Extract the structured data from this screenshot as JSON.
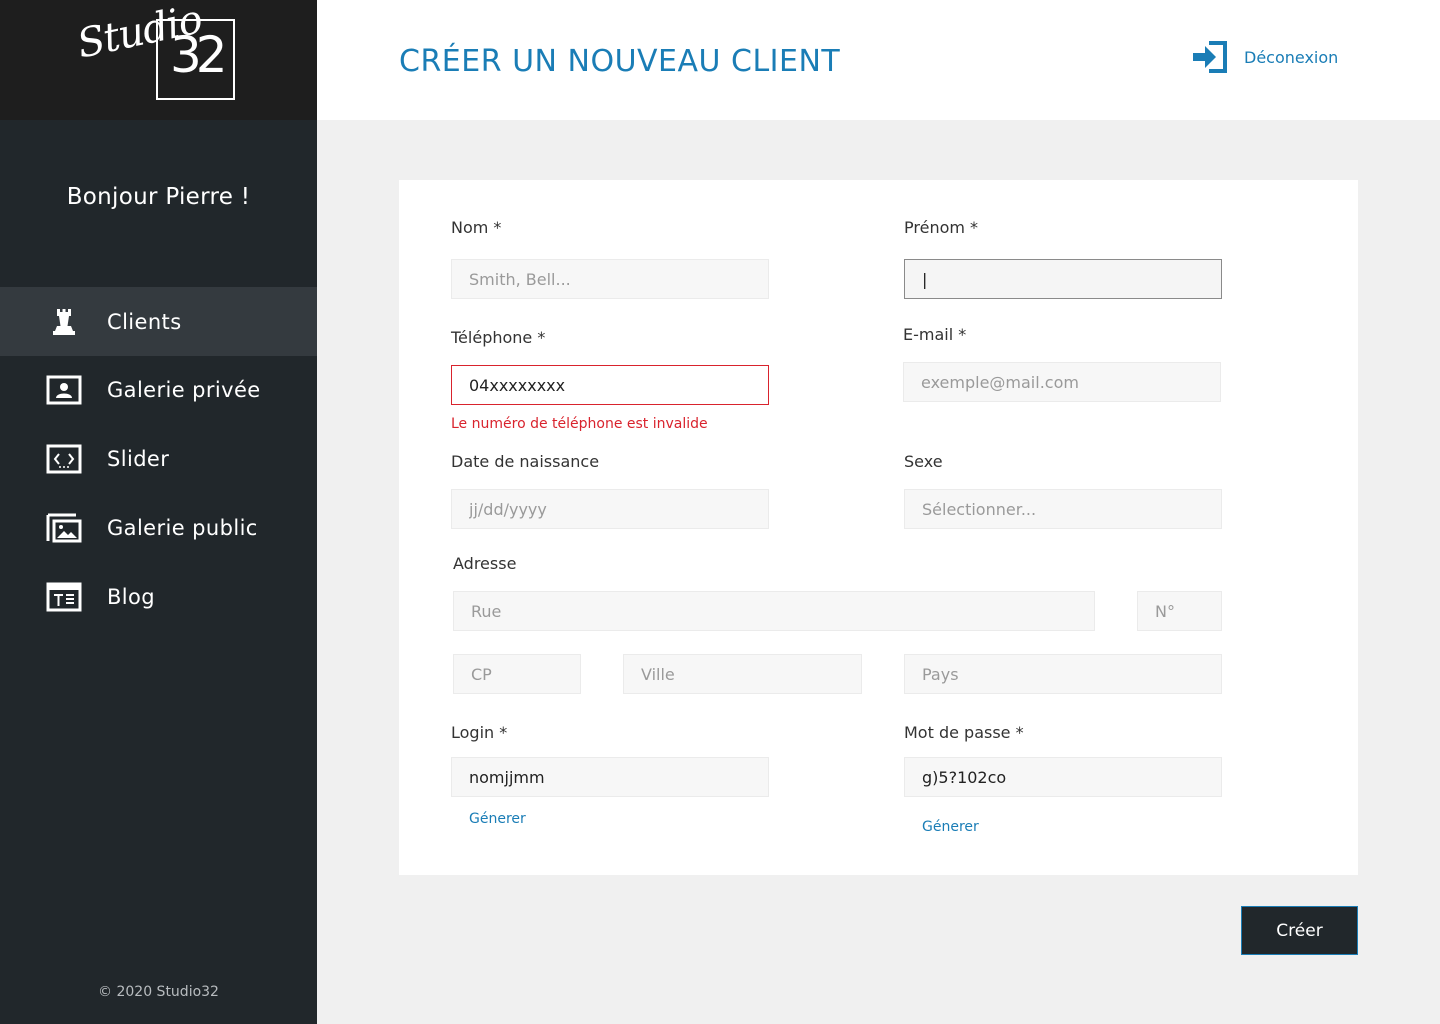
{
  "brand": {
    "script": "Studio",
    "number": "32"
  },
  "sidebar": {
    "greeting": "Bonjour Pierre !",
    "items": [
      {
        "label": "Clients",
        "icon": "chess-piece-icon",
        "active": true
      },
      {
        "label": "Galerie privée",
        "icon": "portrait-frame-icon",
        "active": false
      },
      {
        "label": "Slider",
        "icon": "slider-frame-icon",
        "active": false
      },
      {
        "label": "Galerie public",
        "icon": "image-gallery-icon",
        "active": false
      },
      {
        "label": "Blog",
        "icon": "blog-text-icon",
        "active": false
      }
    ],
    "copyright": "© 2020 Studio32"
  },
  "header": {
    "title": "CRÉER UN NOUVEAU CLIENT",
    "logout_label": "Déconexion",
    "logout_icon": "sign-in-arrow-icon"
  },
  "form": {
    "nom": {
      "label": "Nom *",
      "placeholder": "Smith, Bell...",
      "value": ""
    },
    "prenom": {
      "label": "Prénom *",
      "placeholder": "",
      "value": "|"
    },
    "telephone": {
      "label": "Téléphone *",
      "placeholder": "",
      "value": "04xxxxxxxx",
      "error": "Le numéro de téléphone est invalide"
    },
    "email": {
      "label": "E-mail *",
      "placeholder": "exemple@mail.com",
      "value": ""
    },
    "date_naissance": {
      "label": "Date de naissance",
      "placeholder": "jj/dd/yyyy",
      "value": ""
    },
    "sexe": {
      "label": "Sexe",
      "placeholder": "Sélectionner...",
      "value": ""
    },
    "adresse": {
      "label": "Adresse",
      "rue_placeholder": "Rue",
      "numero_placeholder": "N°",
      "cp_placeholder": "CP",
      "ville_placeholder": "Ville",
      "pays_placeholder": "Pays"
    },
    "login": {
      "label": "Login *",
      "value": "nomjjmm",
      "generate": "Génerer"
    },
    "password": {
      "label": "Mot de passe *",
      "value": "g)5?102co",
      "generate": "Génerer"
    },
    "submit_label": "Créer"
  },
  "colors": {
    "accent": "#1a7db6",
    "sidebar_bg": "#21272b",
    "sidebar_active": "#343a3f",
    "logo_bg": "#1e1e1e",
    "error": "#d9232d",
    "page_bg": "#f0f0f0"
  }
}
